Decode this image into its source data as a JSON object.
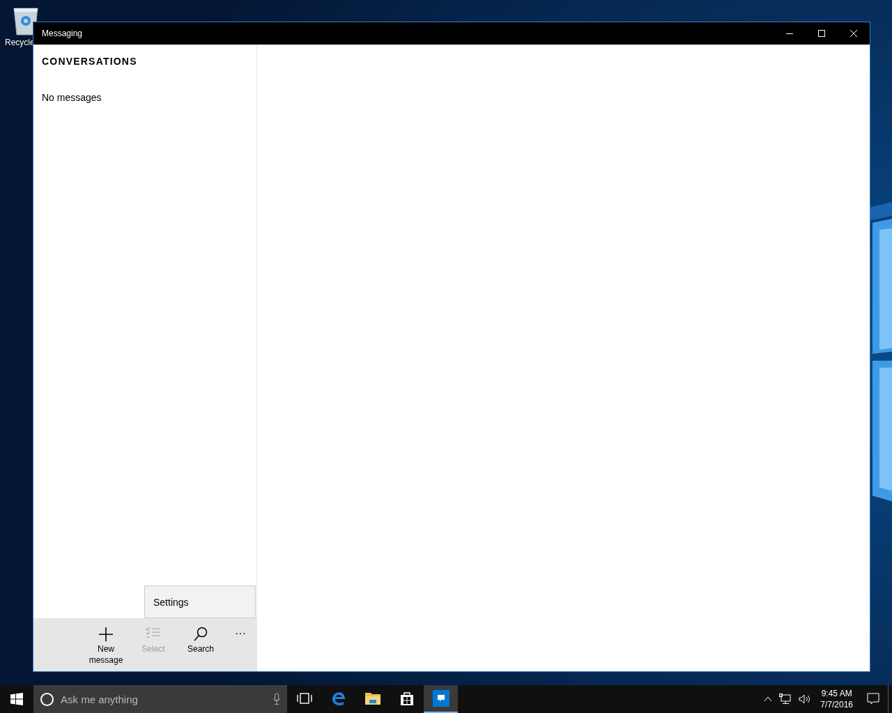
{
  "desktop": {
    "icons": [
      {
        "kind": "recycle-bin",
        "label": "Recycle"
      }
    ]
  },
  "window": {
    "title": "Messaging"
  },
  "sidebar": {
    "heading": "CONVERSATIONS",
    "empty_text": "No messages"
  },
  "menu": {
    "items": [
      {
        "label": "Settings"
      }
    ]
  },
  "app_bar": {
    "buttons": [
      {
        "kind": "new",
        "label": "New message",
        "disabled": false
      },
      {
        "kind": "select",
        "label": "Select",
        "disabled": true
      },
      {
        "kind": "search",
        "label": "Search",
        "disabled": false
      }
    ],
    "more": "···"
  },
  "taskbar": {
    "search": {
      "placeholder": "Ask me anything"
    },
    "apps": [
      {
        "kind": "task-view",
        "active": false
      },
      {
        "kind": "browser",
        "active": false
      },
      {
        "kind": "folder",
        "active": false
      },
      {
        "kind": "store",
        "active": false
      },
      {
        "kind": "messaging",
        "active": true
      }
    ],
    "clock": {
      "time": "9:45 AM",
      "date": "7/7/2016"
    }
  }
}
